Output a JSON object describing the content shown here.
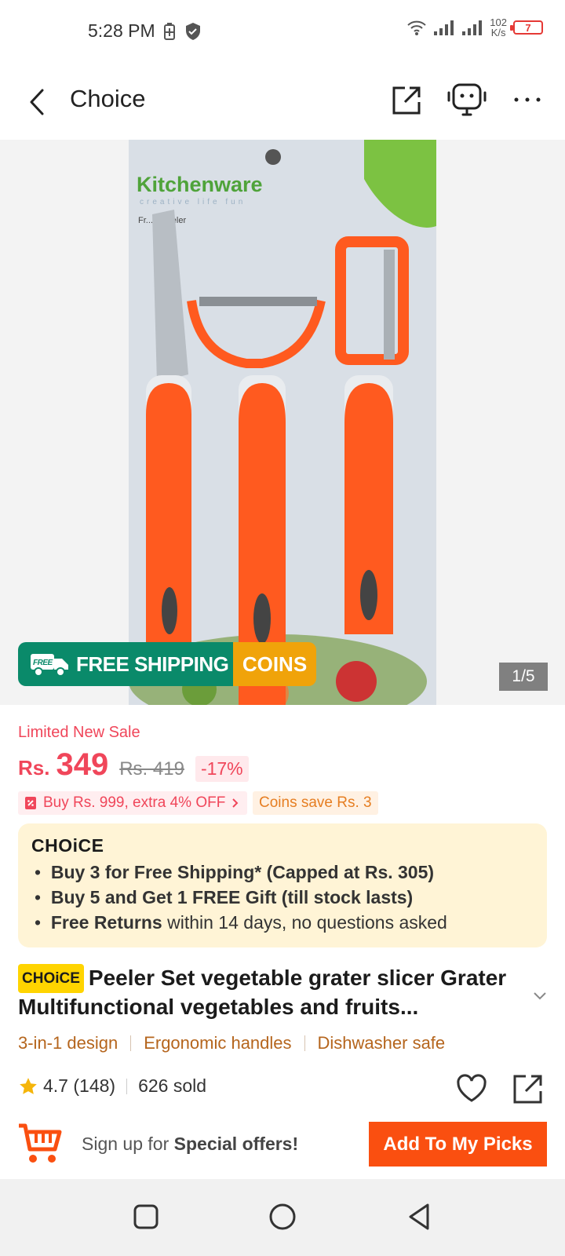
{
  "status": {
    "time": "5:28 PM",
    "speed_value": "102",
    "speed_unit": "K/s",
    "battery": "7"
  },
  "header": {
    "title": "Choice"
  },
  "gallery": {
    "pager": "1/5",
    "banner_ship": "FREE SHIPPING",
    "banner_coins": "COINS",
    "banner_badge": "FREE",
    "package_brand": "Kitchenware",
    "package_tagline": "creative life fun",
    "package_subtitle": "Fr... &Peeler"
  },
  "pricing": {
    "limited": "Limited New Sale",
    "currency": "Rs.",
    "price": "349",
    "old_price": "Rs. 419",
    "discount": "-17%",
    "promo_buy": "Buy Rs. 999, extra 4% OFF",
    "promo_coins": "Coins save Rs. 3"
  },
  "choice": {
    "logo": "CHOiCE",
    "line1_bold": "Buy 3 for  Free Shipping* (Capped at Rs. 305)",
    "line2_bold": "Buy 5 and Get 1 FREE Gift (till stock lasts)",
    "line3_bold": "Free Returns",
    "line3_rest": " within 14 days, no questions asked"
  },
  "product": {
    "tag": "CHOiCE",
    "title": "Peeler Set vegetable grater slicer Grater Multifunctional vegetables and fruits..."
  },
  "features": [
    "3-in-1 design",
    "Ergonomic handles",
    "Dishwasher safe"
  ],
  "rating": {
    "score": "4.7",
    "count": "(148)",
    "sold": "626 sold"
  },
  "bottom": {
    "signup_prefix": "Sign up for ",
    "signup_bold": "Special offers!",
    "add_button": "Add To My Picks"
  },
  "colors": {
    "accent": "#fa4f10",
    "price": "#f0465a",
    "shipping": "#0a8a6a",
    "coins": "#f0a30a",
    "choice_bg": "#fff4d6"
  }
}
